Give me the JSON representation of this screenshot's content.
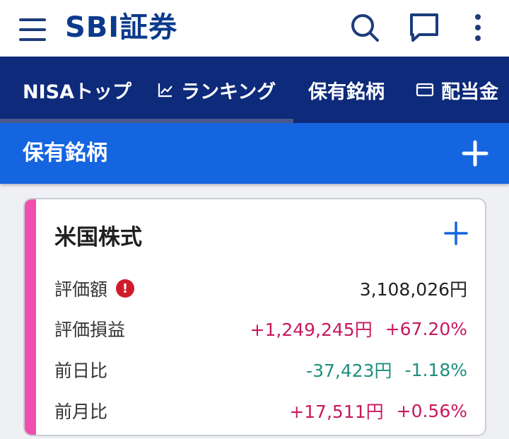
{
  "header": {
    "logo_text": "SBI証券",
    "icons": [
      "menu-icon",
      "search-icon",
      "chat-icon",
      "more-vertical-icon"
    ]
  },
  "tabs": [
    {
      "label": "NISAトップ",
      "active": true
    },
    {
      "label": "ランキング",
      "icon": "chart-line-icon"
    },
    {
      "label": "保有銘柄"
    },
    {
      "label": "配当金",
      "icon": "card-icon"
    }
  ],
  "section": {
    "title": "保有銘柄",
    "add_icon": "plus-icon"
  },
  "card": {
    "title": "米国株式",
    "accent_color": "#ef4fae",
    "rows": [
      {
        "label": "評価額",
        "alert": "!",
        "value": "3,108,026円",
        "change": ""
      },
      {
        "label": "評価損益",
        "value": "+1,249,245円",
        "change": "+67.20%"
      },
      {
        "label": "前日比",
        "value": "-37,423円",
        "change": "-1.18%"
      },
      {
        "label": "前月比",
        "value": "+17,511円",
        "change": "+0.56%"
      }
    ]
  },
  "colors": {
    "brand_navy": "#0b3a8c",
    "tab_bar": "#0e2a7a",
    "title_bar": "#1565e0",
    "positive": "#c8195e",
    "negative": "#1f8f7e"
  }
}
